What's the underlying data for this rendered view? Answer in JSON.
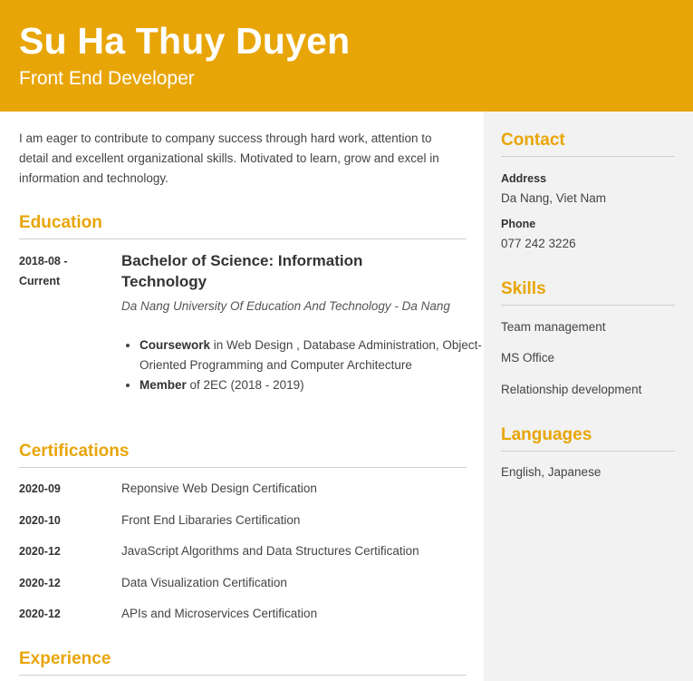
{
  "header": {
    "name": "Su Ha Thuy Duyen",
    "title": "Front End Developer"
  },
  "summary": "I am eager to contribute to company success through hard work, attention to detail and excellent organizational skills. Motivated to learn, grow and excel in information and technology.",
  "education": {
    "heading": "Education",
    "entries": [
      {
        "date_start": "2018-08 -",
        "date_end": "Current",
        "degree": "Bachelor of Science: Information Technology",
        "school": "Da Nang University Of Education And Technology - Da Nang",
        "bullets": [
          {
            "label": "Coursework",
            "text": " in Web Design , Database Administration, Object-Oriented Programming and Computer Architecture"
          },
          {
            "label": "Member",
            "text": " of 2EC (2018 - 2019)"
          }
        ]
      }
    ]
  },
  "certifications": {
    "heading": "Certifications",
    "items": [
      {
        "date": "2020-09",
        "name": "Reponsive Web Design Certification"
      },
      {
        "date": "2020-10",
        "name": "Front End Libararies Certification"
      },
      {
        "date": "2020-12",
        "name": "JavaScript Algorithms and Data Structures Certification"
      },
      {
        "date": "2020-12",
        "name": "Data Visualization Certification"
      },
      {
        "date": "2020-12",
        "name": "APIs and Microservices Certification"
      }
    ]
  },
  "experience": {
    "heading": "Experience"
  },
  "contact": {
    "heading": "Contact",
    "address_label": "Address",
    "address": "Da Nang, Viet Nam",
    "phone_label": "Phone",
    "phone": "077 242 3226"
  },
  "skills": {
    "heading": "Skills",
    "items": [
      "Team management",
      "MS Office",
      "Relationship development"
    ]
  },
  "languages": {
    "heading": "Languages",
    "text": "English, Japanese"
  },
  "colors": {
    "accent": "#e8a508",
    "sidebar_bg": "#f2f2f2"
  }
}
